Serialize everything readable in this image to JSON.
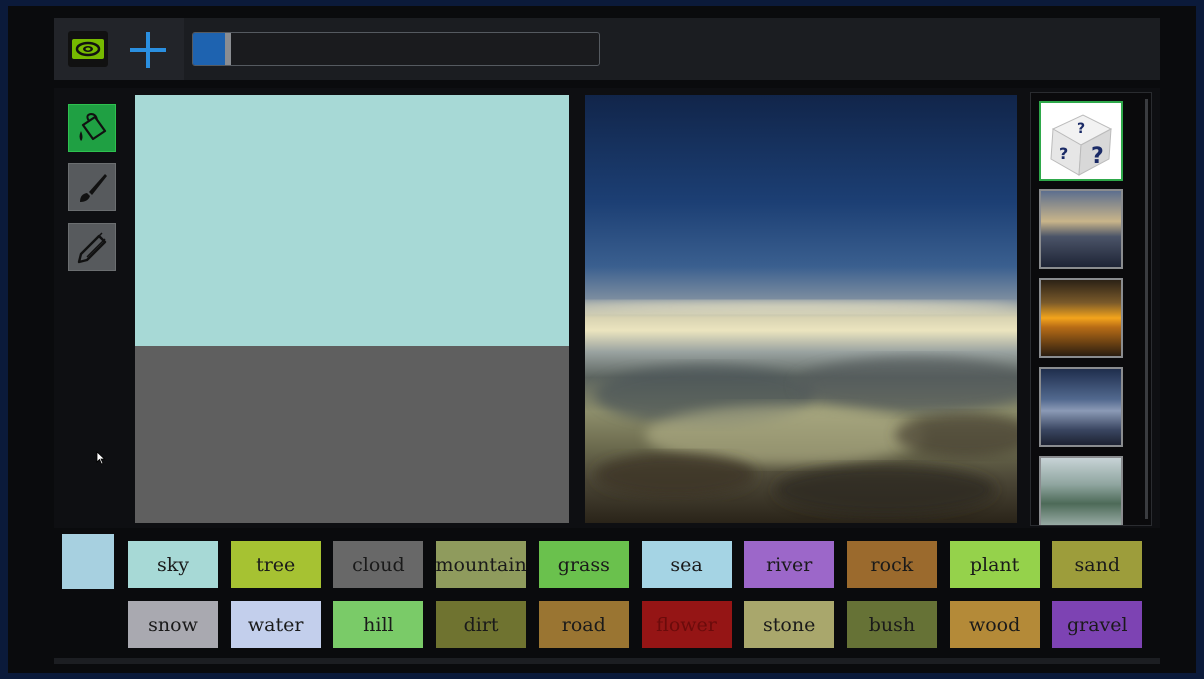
{
  "app": {
    "logo_icon": "nvidia-logo-icon",
    "new_icon": "plus-icon"
  },
  "progress": {
    "fraction": 0.08
  },
  "tools": [
    {
      "id": "fill",
      "icon": "paint-bucket-icon",
      "active": true
    },
    {
      "id": "brush",
      "icon": "brush-icon",
      "active": false
    },
    {
      "id": "pencil",
      "icon": "pencil-icon",
      "active": false
    }
  ],
  "canvas": {
    "regions": [
      {
        "label": "sky",
        "color": "#a7d9d6"
      },
      {
        "label": "grass",
        "color": "#5f5f5f"
      }
    ]
  },
  "styles": [
    {
      "icon": "random-dice-icon",
      "active": true
    },
    {
      "icon": "city-sunset-thumbnail",
      "active": false
    },
    {
      "icon": "sea-sunset-thumbnail",
      "active": false
    },
    {
      "icon": "cloudy-sky-thumbnail",
      "active": false
    },
    {
      "icon": "lake-trees-thumbnail",
      "active": false
    }
  ],
  "selected_color": "#a7d0e0",
  "labels": [
    {
      "text": "sky",
      "color": "#a7d9d6"
    },
    {
      "text": "tree",
      "color": "#a6c232"
    },
    {
      "text": "cloud",
      "color": "#686868"
    },
    {
      "text": "mountain",
      "color": "#8f9b5d"
    },
    {
      "text": "grass",
      "color": "#6ac14d"
    },
    {
      "text": "sea",
      "color": "#a5d4e4"
    },
    {
      "text": "river",
      "color": "#9c67c9"
    },
    {
      "text": "rock",
      "color": "#9b6a2d"
    },
    {
      "text": "plant",
      "color": "#95d24b"
    },
    {
      "text": "sand",
      "color": "#9d9d3b"
    },
    {
      "text": "snow",
      "color": "#a9a9b0"
    },
    {
      "text": "water",
      "color": "#c3cfec"
    },
    {
      "text": "hill",
      "color": "#7acb68"
    },
    {
      "text": "dirt",
      "color": "#6f7330"
    },
    {
      "text": "road",
      "color": "#9a7532"
    },
    {
      "text": "flower",
      "color": "#951515"
    },
    {
      "text": "stone",
      "color": "#a9a76c"
    },
    {
      "text": "bush",
      "color": "#667236"
    },
    {
      "text": "wood",
      "color": "#b48a38"
    },
    {
      "text": "gravel",
      "color": "#7d43b3"
    }
  ]
}
